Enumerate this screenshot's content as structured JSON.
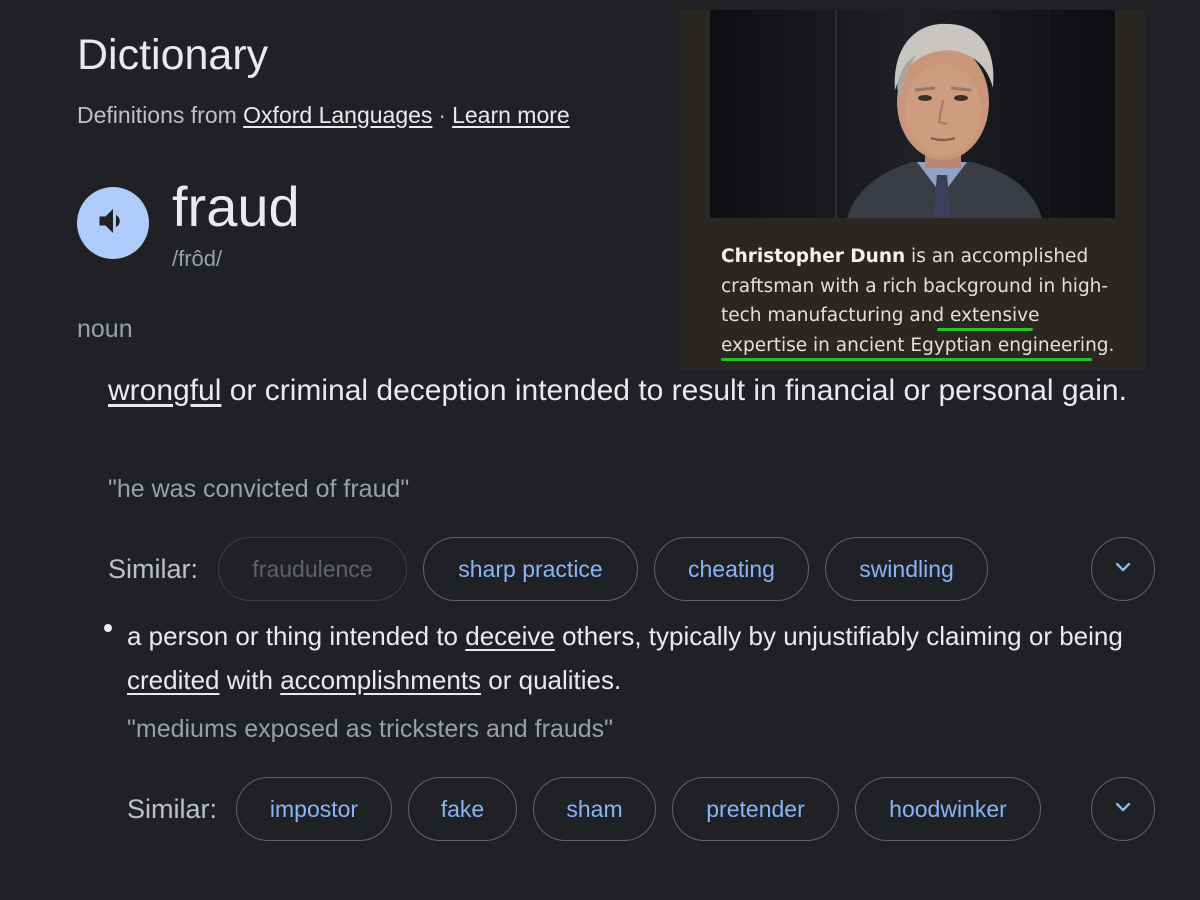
{
  "header": {
    "title": "Dictionary",
    "source_prefix": "Definitions from",
    "source_link": "Oxford Languages",
    "separator": "·",
    "learn_more": "Learn more"
  },
  "entry": {
    "word": "fraud",
    "pronunciation": "/frôd/",
    "part_of_speech": "noun",
    "speaker_icon": "volume-icon"
  },
  "definitions": [
    {
      "text_parts": [
        "wrongful",
        " or criminal deception intended to result in financial or personal gain."
      ],
      "example": "\"he was convicted of fraud\"",
      "similar_label": "Similar:",
      "similar": [
        {
          "label": "fraudulence",
          "disabled": true
        },
        {
          "label": "sharp practice",
          "disabled": false
        },
        {
          "label": "cheating",
          "disabled": false
        },
        {
          "label": "swindling",
          "disabled": false
        }
      ]
    },
    {
      "text_parts": [
        "a person or thing intended to ",
        "deceive",
        " others, typically by unjustifiably claiming or being ",
        "credited",
        " with ",
        "accomplishments",
        " or qualities."
      ],
      "example": "\"mediums exposed as tricksters and frauds\"",
      "similar_label": "Similar:",
      "similar": [
        {
          "label": "impostor",
          "disabled": false
        },
        {
          "label": "fake",
          "disabled": false
        },
        {
          "label": "sham",
          "disabled": false
        },
        {
          "label": "pretender",
          "disabled": false
        },
        {
          "label": "hoodwinker",
          "disabled": false
        }
      ]
    }
  ],
  "overlay": {
    "name": "Christopher Dunn",
    "lines": [
      " is an accomplished",
      "craftsman with a rich background in high-",
      "tech manufacturing and ",
      "extensive",
      "expertise in ancient Egyptian engineering."
    ],
    "highlight_color": "#22c322"
  },
  "colors": {
    "background": "#202124",
    "link_blue": "#8ab4f8",
    "speaker_bg": "#aecbfa"
  }
}
